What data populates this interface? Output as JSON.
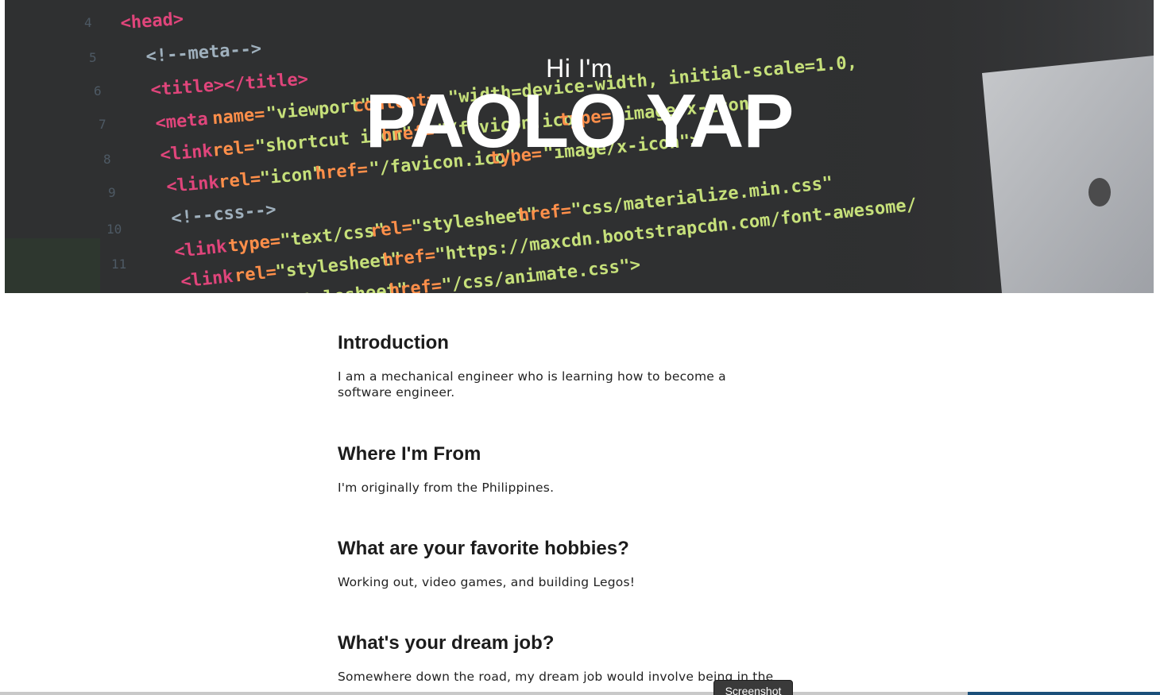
{
  "hero": {
    "greeting": "Hi I'm",
    "name": "PAOLO YAP"
  },
  "sections": [
    {
      "heading": "Introduction",
      "body": "I am a mechanical engineer who is learning how to become a software engineer."
    },
    {
      "heading": "Where I'm From",
      "body": "I'm originally from the Philippines."
    },
    {
      "heading": "What are your favorite hobbies?",
      "body": "Working out, video games, and building Legos!"
    },
    {
      "heading": "What's your dream job?",
      "body": "Somewhere down the road, my dream job would involve being in the"
    }
  ],
  "overlay": {
    "screenshot_label": "Screenshot"
  },
  "colors": {
    "hero_background": "#2e2f30",
    "code_tag": "#e0457b",
    "code_attr": "#ff8f4a",
    "code_string": "#c6e07a",
    "text": "#222222"
  }
}
